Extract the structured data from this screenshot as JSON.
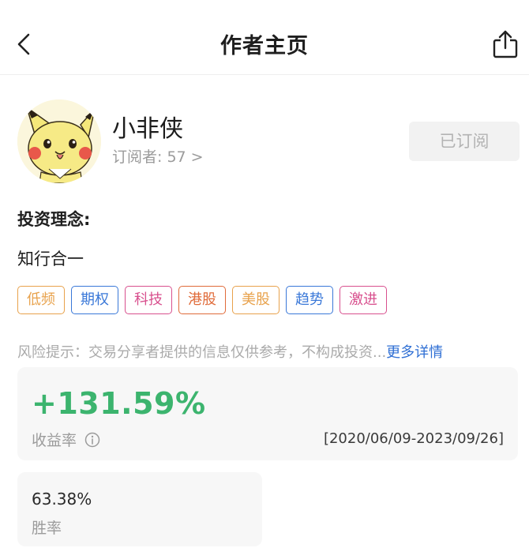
{
  "header": {
    "title": "作者主页",
    "back_icon": "chevron-left-icon",
    "share_icon": "share-icon"
  },
  "author": {
    "name": "小非侠",
    "subscribers_label": "订阅者",
    "subscribers_text": "订阅者: 57",
    "subscribers_count": 57,
    "subscribe_button": "已订阅"
  },
  "philosophy": {
    "label": "投资理念:",
    "text": "知行合一"
  },
  "tags": [
    {
      "label": "低频",
      "color": "#e8a24c"
    },
    {
      "label": "期权",
      "color": "#3a78d8"
    },
    {
      "label": "科技",
      "color": "#d8508e"
    },
    {
      "label": "港股",
      "color": "#e06b3a"
    },
    {
      "label": "美股",
      "color": "#e8a24c"
    },
    {
      "label": "趋势",
      "color": "#3a78d8"
    },
    {
      "label": "激进",
      "color": "#d8508e"
    }
  ],
  "risk": {
    "text": "风险提示：交易分享者提供的信息仅供参考，不构成投资...",
    "more_link": "更多详情"
  },
  "stats": {
    "return_value": "+131.59%",
    "return_label": "收益率",
    "date_range": "[2020/06/09-2023/09/26]",
    "win_rate_value": "63.38%",
    "win_rate_label": "胜率"
  },
  "colors": {
    "positive": "#3cb46e",
    "link": "#2f6fd4",
    "muted": "#9b9b9b",
    "card_bg": "#f7f7f7"
  }
}
